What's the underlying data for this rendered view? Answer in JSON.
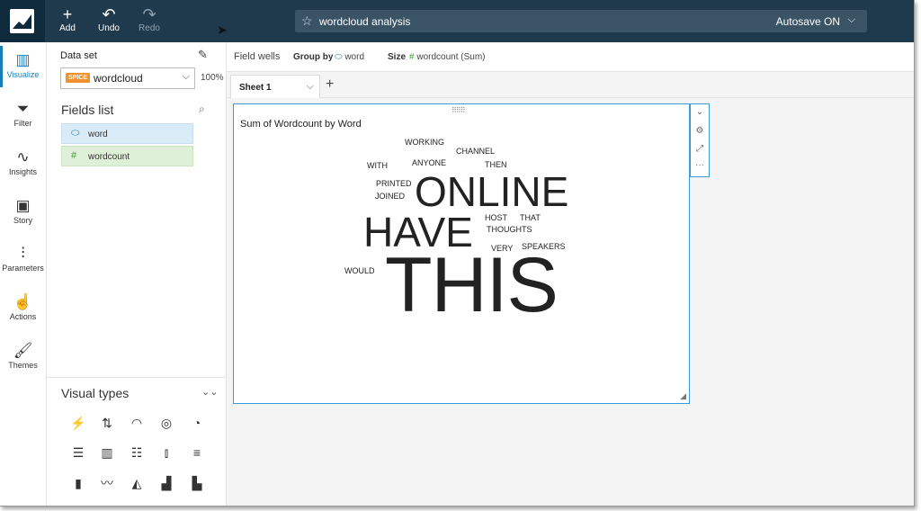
{
  "topbar": {
    "add_label": "Add",
    "undo_label": "Undo",
    "redo_label": "Redo",
    "analysis_name": "wordcloud analysis",
    "autosave_label": "Autosave ON"
  },
  "nav": {
    "items": [
      {
        "label": "Visualize",
        "icon": "bar-chart-icon"
      },
      {
        "label": "Filter",
        "icon": "funnel-icon"
      },
      {
        "label": "Insights",
        "icon": "insights-icon"
      },
      {
        "label": "Story",
        "icon": "story-icon"
      },
      {
        "label": "Parameters",
        "icon": "sliders-icon"
      },
      {
        "label": "Actions",
        "icon": "actions-icon"
      },
      {
        "label": "Themes",
        "icon": "brush-icon"
      }
    ]
  },
  "dataset": {
    "label": "Data set",
    "badge": "SPICE",
    "name": "wordcloud",
    "percent": "100%"
  },
  "fields": {
    "title": "Fields list",
    "items": [
      {
        "name": "word",
        "type": "dimension"
      },
      {
        "name": "wordcount",
        "type": "measure"
      }
    ]
  },
  "visual_types": {
    "title": "Visual types"
  },
  "field_wells": {
    "label": "Field wells",
    "group_by_label": "Group by",
    "group_by_value": "word",
    "size_label": "Size",
    "size_value": "wordcount (Sum)"
  },
  "sheet": {
    "tab_label": "Sheet 1"
  },
  "visual": {
    "title": "Sum of Wordcount by Word",
    "words": [
      "WORKING",
      "CHANNEL",
      "WITH",
      "ANYONE",
      "THEN",
      "PRINTED",
      "JOINED",
      "ONLINE",
      "HOST",
      "THAT",
      "HAVE",
      "THOUGHTS",
      "VERY",
      "SPEAKERS",
      "WOULD",
      "THIS"
    ]
  },
  "colors": {
    "topbar": "#1f3a4d",
    "accent": "#1a7fb8",
    "spice": "#f0912c",
    "measure": "#3f9c35"
  }
}
